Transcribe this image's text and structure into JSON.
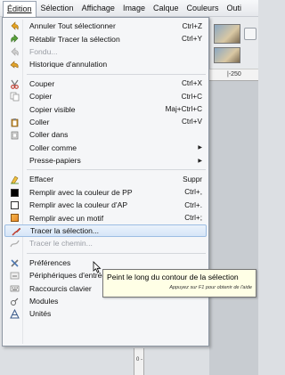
{
  "menubar": {
    "items": [
      {
        "label": "Édition",
        "ul": "É",
        "rest": "dition",
        "active": true
      },
      {
        "label": "Sélection"
      },
      {
        "label": "Affichage"
      },
      {
        "label": "Image"
      },
      {
        "label": "Calque"
      },
      {
        "label": "Couleurs"
      },
      {
        "label": "Outi"
      }
    ]
  },
  "background": {
    "ruler_label": "|-250",
    "vruler_label": "0 -"
  },
  "menu": {
    "items": [
      {
        "label": "Annuler Tout sélectionner",
        "shortcut": "Ctrl+Z",
        "icon": "undo-icon"
      },
      {
        "label": "Rétablir Tracer la sélection",
        "shortcut": "Ctrl+Y",
        "icon": "redo-icon"
      },
      {
        "label": "Fondu...",
        "shortcut": "",
        "icon": "fade-icon",
        "disabled": true
      },
      {
        "label": "Historique d'annulation",
        "shortcut": "",
        "icon": "history-icon"
      },
      {
        "label": "Couper",
        "shortcut": "Ctrl+X",
        "icon": "cut-icon"
      },
      {
        "label": "Copier",
        "shortcut": "Ctrl+C",
        "icon": "copy-icon"
      },
      {
        "label": "Copier visible",
        "shortcut": "Maj+Ctrl+C",
        "icon": ""
      },
      {
        "label": "Coller",
        "shortcut": "Ctrl+V",
        "icon": "paste-icon"
      },
      {
        "label": "Coller dans",
        "shortcut": "",
        "icon": "paste-into-icon"
      },
      {
        "label": "Coller comme",
        "shortcut": "",
        "icon": "",
        "submenu": true
      },
      {
        "label": "Presse-papiers",
        "shortcut": "",
        "icon": "",
        "submenu": true
      },
      {
        "label": "Effacer",
        "shortcut": "Suppr",
        "icon": "clear-icon"
      },
      {
        "label": "Remplir avec la couleur de PP",
        "shortcut": "Ctrl+,",
        "icon": "fill-fg-icon"
      },
      {
        "label": "Remplir avec la couleur d'AP",
        "shortcut": "Ctrl+.",
        "icon": "fill-bg-icon"
      },
      {
        "label": "Remplir avec un motif",
        "shortcut": "Ctrl+;",
        "icon": "fill-pattern-icon"
      },
      {
        "label": "Tracer la sélection...",
        "shortcut": "",
        "icon": "stroke-selection-icon",
        "highlighted": true
      },
      {
        "label": "Tracer le chemin...",
        "shortcut": "",
        "icon": "stroke-path-icon",
        "disabled": true
      },
      {
        "label": "Préférences",
        "shortcut": "",
        "icon": "preferences-icon"
      },
      {
        "label": "Périphériques d'entrée",
        "shortcut": "",
        "icon": "input-devices-icon"
      },
      {
        "label": "Raccourcis clavier",
        "shortcut": "",
        "icon": "keyboard-icon"
      },
      {
        "label": "Modules",
        "shortcut": "",
        "icon": "modules-icon"
      },
      {
        "label": "Unités",
        "shortcut": "",
        "icon": "units-icon"
      }
    ]
  },
  "tooltip": {
    "text": "Peint le long du contour de la sélection",
    "help": "Appuyez sur F1 pour obtenir de l'aide"
  },
  "colors": {
    "highlight": "#d6e6f8",
    "tooltip_bg": "#ffffe6",
    "fill_fg": "#000000",
    "fill_bg": "#ffffff",
    "pattern": "#f0a040"
  }
}
